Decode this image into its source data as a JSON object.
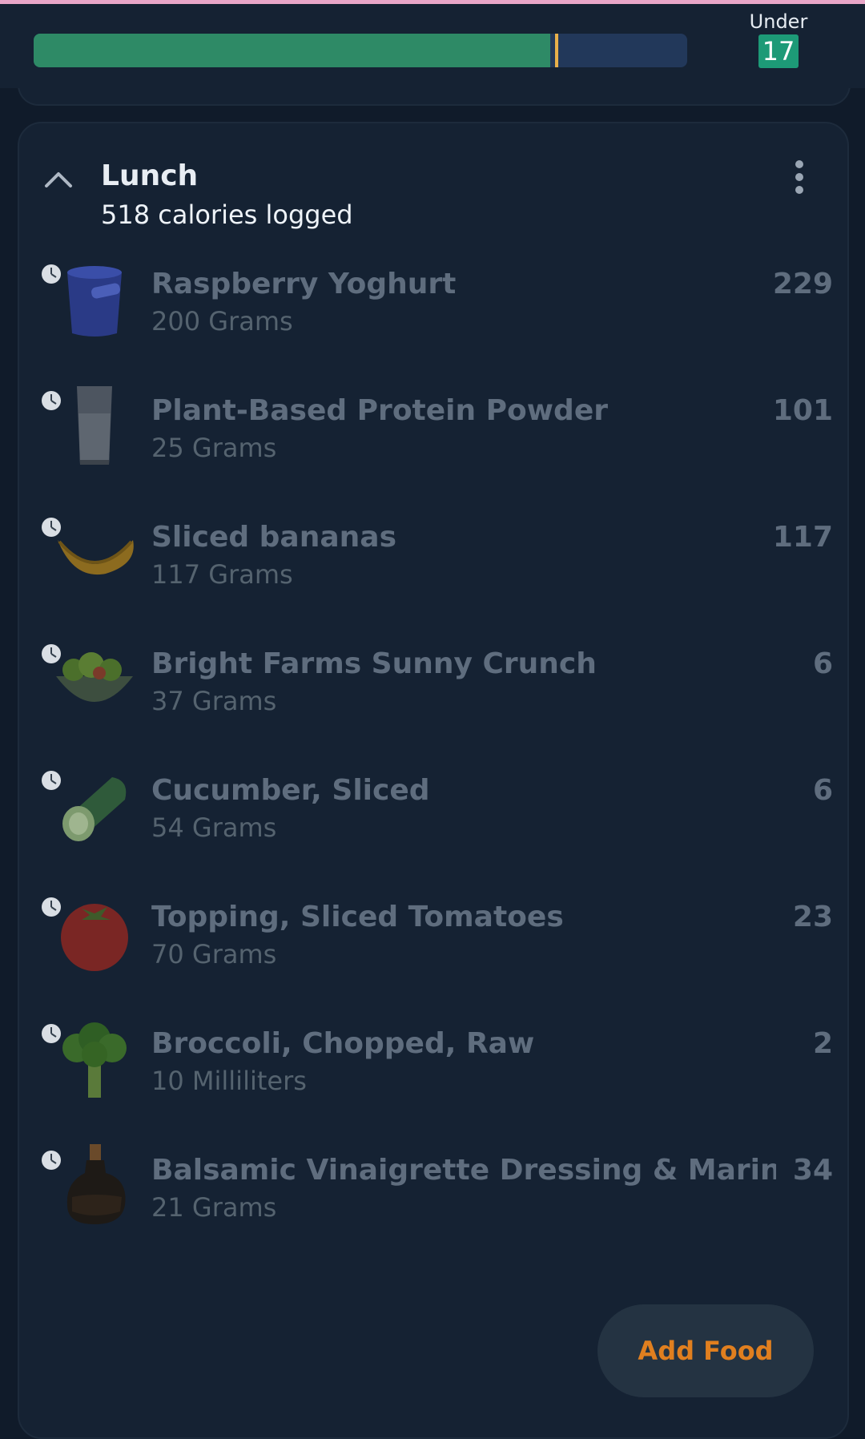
{
  "colors": {
    "background": "#101b2a",
    "card": "#152233",
    "progress_fill": "#2e8a66",
    "progress_track": "#22385a",
    "progress_marker": "#e8b04a",
    "badge": "#1d9a77",
    "add_food_text": "#e07f1f",
    "top_accent": "#e8a6c8"
  },
  "budget": {
    "progress_fraction": 0.79,
    "marker_fraction": 0.8,
    "under_label": "Under",
    "under_value": "17"
  },
  "meal": {
    "title": "Lunch",
    "subtitle": "518 calories logged",
    "collapse_icon": "chevron-up-icon",
    "menu_icon": "more-vertical-icon"
  },
  "foods": [
    {
      "name": "Raspberry Yoghurt",
      "quantity": "200 Grams",
      "calories": "229",
      "icon": "yoghurt-cup-icon"
    },
    {
      "name": "Plant-Based Protein Powder",
      "quantity": "25 Grams",
      "calories": "101",
      "icon": "protein-shake-glass-icon"
    },
    {
      "name": "Sliced bananas",
      "quantity": "117 Grams",
      "calories": "117",
      "icon": "banana-icon"
    },
    {
      "name": "Bright Farms Sunny Crunch",
      "quantity": "37 Grams",
      "calories": "6",
      "icon": "salad-bowl-icon"
    },
    {
      "name": "Cucumber, Sliced",
      "quantity": "54 Grams",
      "calories": "6",
      "icon": "cucumber-icon"
    },
    {
      "name": "Topping, Sliced Tomatoes",
      "quantity": "70 Grams",
      "calories": "23",
      "icon": "tomato-icon"
    },
    {
      "name": "Broccoli, Chopped, Raw",
      "quantity": "10 Milliliters",
      "calories": "2",
      "icon": "broccoli-icon"
    },
    {
      "name": "Balsamic Vinaigrette Dressing & Marinad..",
      "quantity": "21 Grams",
      "calories": "34",
      "icon": "vinegar-bottle-icon"
    }
  ],
  "add_food_label": "Add Food"
}
